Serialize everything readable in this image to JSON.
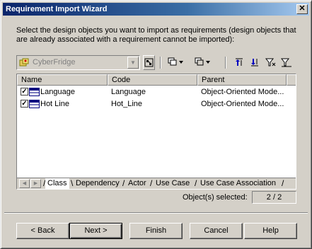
{
  "window": {
    "title": "Requirement Import Wizard",
    "close_glyph": "✕"
  },
  "instructions": "Select the design objects you want to import as requirements (design objects that are already associated with a requirement cannot be imported):",
  "toolbar": {
    "model_select_value": "CyberFridge",
    "dropdown_arrow": "▼",
    "icons": [
      "diagram-select-icon",
      "select-all-icon",
      "deselect-all-icon",
      "move-to-top-icon",
      "move-to-bottom-icon",
      "filter-icon",
      "clear-filter-icon"
    ]
  },
  "list": {
    "columns": [
      "Name",
      "Code",
      "Parent"
    ],
    "rows": [
      {
        "checked": true,
        "name": "Language",
        "code": "Language",
        "parent": "Object-Oriented Mode..."
      },
      {
        "checked": true,
        "name": "Hot Line",
        "code": "Hot_Line",
        "parent": "Object-Oriented Mode..."
      }
    ]
  },
  "tabs": [
    "Class",
    "Dependency",
    "Actor",
    "Use Case",
    "Use Case Association"
  ],
  "active_tab": "Class",
  "status": {
    "label": "Object(s) selected:",
    "value": "2 / 2"
  },
  "buttons": {
    "back": "< Back",
    "next": "Next >",
    "finish": "Finish",
    "cancel": "Cancel",
    "help": "Help"
  },
  "colors": {
    "titlebar_start": "#0a246a",
    "titlebar_end": "#a6caf0",
    "face": "#d4d0c8"
  }
}
